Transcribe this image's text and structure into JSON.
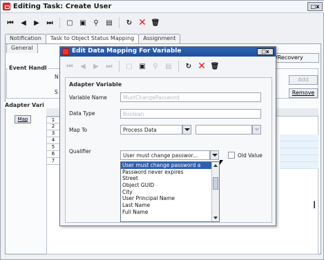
{
  "outer_window": {
    "title": "Editing Task: Create User",
    "window_buttons": "□x",
    "tabs": [
      "Notification",
      "Task to Object Status Mapping",
      "Assignment"
    ],
    "sub_tab": "General",
    "right_tab": "/Recovery",
    "event_handler_label": "Event Handl",
    "event_handler_n": "N",
    "event_handler_s": "S",
    "adapter_vars_label": "Adapter Vari",
    "map_button": "Map",
    "row_numbers": [
      "1",
      "2",
      "3",
      "4",
      "5",
      "6",
      "7"
    ],
    "add_button": "Add",
    "remove_button": "Remove"
  },
  "dialog": {
    "title": "Edit Data Mapping For Variable",
    "window_buttons": "□x",
    "group_label": "Adapter Variable",
    "fields": {
      "variable_name_label": "Variable Name",
      "variable_name_value": "MustChangePassword",
      "data_type_label": "Data Type",
      "data_type_value": "Boolean",
      "map_to_label": "Map To",
      "map_to_value": "Process Data",
      "qualifier_label": "Qualifier",
      "qualifier_value": "User must change passwor...",
      "old_value_label": "Old Value"
    },
    "qualifier_options": [
      "User must change password a",
      "Password never expires",
      "Street",
      "Object GUID",
      "City",
      "User Principal Name",
      "Last Name",
      "Full Name"
    ],
    "selected_option_index": 0
  },
  "icons": {
    "toolbar": [
      "first-icon",
      "prev-icon",
      "next-icon",
      "last-icon",
      "new-icon",
      "save-icon",
      "find-icon",
      "clipboard-icon",
      "refresh-icon",
      "delete-icon",
      "trash-icon"
    ]
  },
  "colors": {
    "dialog_title_bg": "#2e63b5",
    "selected_item_bg": "#2f5fb0",
    "delete_red": "#e21b1b"
  }
}
